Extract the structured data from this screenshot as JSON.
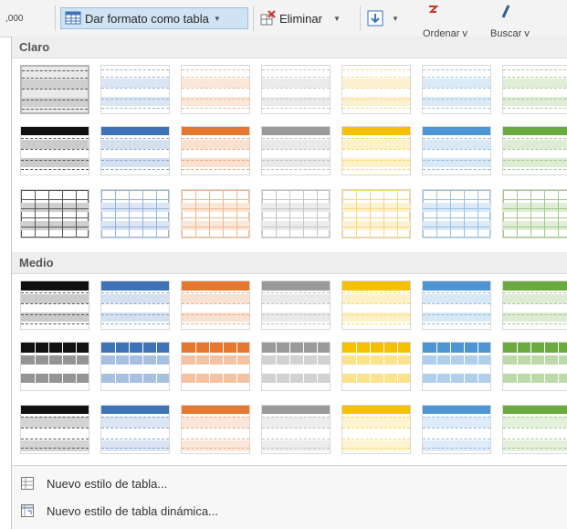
{
  "ribbon": {
    "number_format_label": ",000",
    "format_as_table_label": "Dar formato como tabla",
    "delete_label": "Eliminar",
    "sort_filter_label": "Ordenar y",
    "find_select_label": "Buscar y"
  },
  "gallery": {
    "sections": [
      {
        "title": "Claro",
        "rows": [
          {
            "style": "rows",
            "colors": [
              "#262626",
              "#5b8ac8",
              "#e8904f",
              "#a5a5a5",
              "#f1c232",
              "#5a9fd6",
              "#70ad47"
            ]
          },
          {
            "style": "header",
            "colors": [
              "#111111",
              "#3e73b8",
              "#e5782e",
              "#9a9a9a",
              "#f5c000",
              "#4e95d3",
              "#6aaa3f"
            ]
          },
          {
            "style": "grid",
            "colors": [
              "#262626",
              "#5b8ac8",
              "#e8904f",
              "#a5a5a5",
              "#f1c232",
              "#5a9fd6",
              "#70ad47"
            ]
          }
        ]
      },
      {
        "title": "Medio",
        "rows": [
          {
            "style": "header-thick",
            "colors": [
              "#111111",
              "#3e73b8",
              "#e5782e",
              "#9a9a9a",
              "#f5c000",
              "#4e95d3",
              "#6aaa3f"
            ]
          },
          {
            "style": "banded-grid",
            "colors": [
              "#111111",
              "#3e73b8",
              "#e5782e",
              "#9a9a9a",
              "#f5c000",
              "#4e95d3",
              "#6aaa3f"
            ]
          },
          {
            "style": "dark-header",
            "colors": [
              "#111111",
              "#3e73b8",
              "#e5782e",
              "#9a9a9a",
              "#f5c000",
              "#4e95d3",
              "#6aaa3f"
            ]
          }
        ]
      }
    ]
  },
  "menu": {
    "new_table_style": "Nuevo estilo de tabla...",
    "new_pivot_style": "Nuevo estilo de tabla dinámica..."
  }
}
